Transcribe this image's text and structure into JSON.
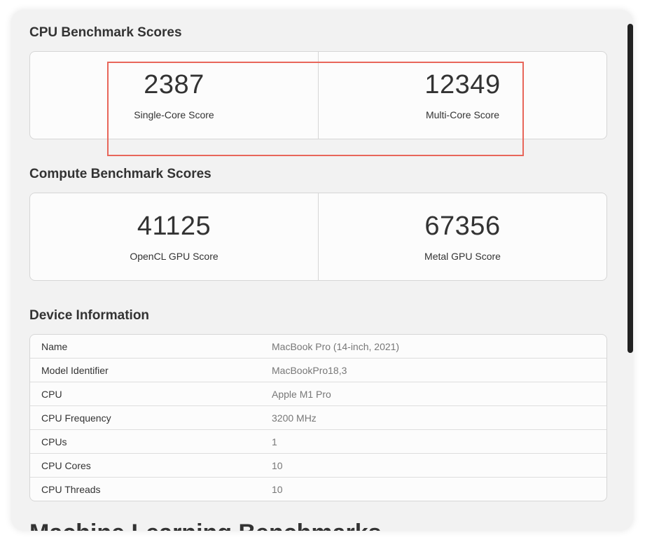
{
  "cpu_section": {
    "title": "CPU Benchmark Scores",
    "scores": [
      {
        "value": "2387",
        "label": "Single-Core Score"
      },
      {
        "value": "12349",
        "label": "Multi-Core Score"
      }
    ]
  },
  "compute_section": {
    "title": "Compute Benchmark Scores",
    "scores": [
      {
        "value": "41125",
        "label": "OpenCL GPU Score"
      },
      {
        "value": "67356",
        "label": "Metal GPU Score"
      }
    ]
  },
  "device_section": {
    "title": "Device Information",
    "rows": [
      {
        "key": "Name",
        "value": "MacBook Pro (14-inch, 2021)"
      },
      {
        "key": "Model Identifier",
        "value": "MacBookPro18,3"
      },
      {
        "key": "CPU",
        "value": "Apple M1 Pro"
      },
      {
        "key": "CPU Frequency",
        "value": "3200 MHz"
      },
      {
        "key": "CPUs",
        "value": "1"
      },
      {
        "key": "CPU Cores",
        "value": "10"
      },
      {
        "key": "CPU Threads",
        "value": "10"
      }
    ]
  },
  "next_section": {
    "title_partial": "Machine Learning Benchmarks"
  },
  "colors": {
    "highlight": "#e8665a",
    "background": "#f2f2f2",
    "card": "#fcfcfc"
  }
}
